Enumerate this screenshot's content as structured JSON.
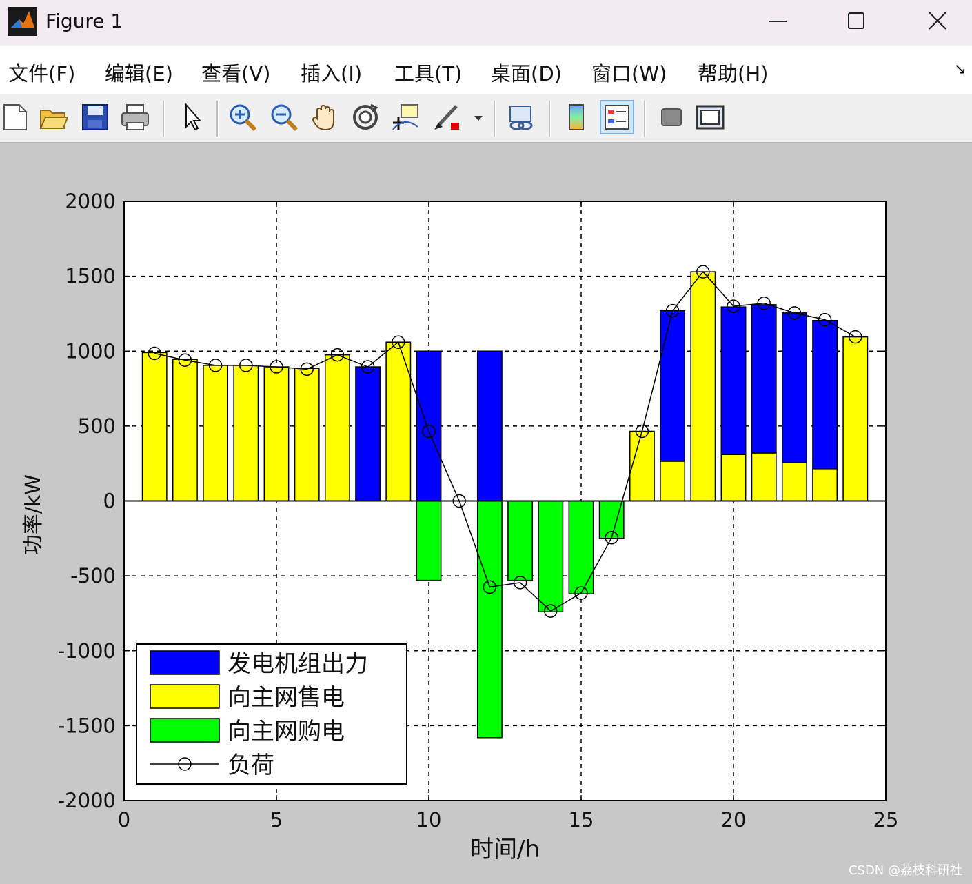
{
  "window": {
    "title": "Figure 1"
  },
  "menu": [
    {
      "label": "文件(F)"
    },
    {
      "label": "编辑(E)"
    },
    {
      "label": "查看(V)"
    },
    {
      "label": "插入(I)"
    },
    {
      "label": "工具(T)"
    },
    {
      "label": "桌面(D)"
    },
    {
      "label": "窗口(W)"
    },
    {
      "label": "帮助(H)"
    }
  ],
  "toolbar_icons": [
    "new-file-icon",
    "open-folder-icon",
    "save-icon",
    "print-icon",
    "pointer-icon",
    "zoom-in-icon",
    "zoom-out-icon",
    "pan-hand-icon",
    "rotate-3d-icon",
    "data-cursor-icon",
    "brush-icon",
    "brush-dropdown-icon",
    "link-plot-icon",
    "colorbar-icon",
    "legend-icon",
    "hide-plot-tools-icon",
    "show-plot-tools-icon"
  ],
  "colors": {
    "generator": "#0000ff",
    "sell": "#ffff00",
    "buy": "#00ff00",
    "load": "#000000",
    "titlebar": "#f4eaf2",
    "figure_bg": "#c8c8c8"
  },
  "watermark": "CSDN @荔枝科研社",
  "chart_data": {
    "type": "bar",
    "xlabel": "时间/h",
    "ylabel": "功率/kW",
    "xlim": [
      0,
      25
    ],
    "ylim": [
      -2000,
      2000
    ],
    "xticks": [
      0,
      5,
      10,
      15,
      20,
      25
    ],
    "yticks": [
      -2000,
      -1500,
      -1000,
      -500,
      0,
      500,
      1000,
      1500,
      2000
    ],
    "grid": true,
    "legend_position": "bottom-left",
    "x": [
      1,
      2,
      3,
      4,
      5,
      6,
      7,
      8,
      9,
      10,
      11,
      12,
      13,
      14,
      15,
      16,
      17,
      18,
      19,
      20,
      21,
      22,
      23,
      24
    ],
    "series": [
      {
        "name": "发电机组出力",
        "color": "#0000ff",
        "values": [
          0,
          0,
          0,
          0,
          0,
          0,
          0,
          895,
          0,
          1000,
          0,
          1000,
          0,
          0,
          0,
          0,
          0,
          1005,
          0,
          985,
          990,
          1000,
          990,
          0
        ]
      },
      {
        "name": "向主网售电",
        "color": "#ffff00",
        "values": [
          990,
          945,
          905,
          905,
          895,
          885,
          975,
          0,
          1060,
          0,
          0,
          0,
          0,
          0,
          0,
          0,
          465,
          265,
          1530,
          310,
          320,
          255,
          215,
          1095
        ]
      },
      {
        "name": "向主网购电",
        "color": "#00ff00",
        "values": [
          0,
          0,
          0,
          0,
          0,
          0,
          0,
          0,
          0,
          -530,
          0,
          -1580,
          -530,
          -740,
          -620,
          -250,
          0,
          0,
          0,
          0,
          0,
          0,
          0,
          0
        ]
      },
      {
        "name": "负荷",
        "color": "#000000",
        "type": "line",
        "marker": "circle",
        "values": [
          985,
          940,
          905,
          905,
          895,
          880,
          975,
          895,
          1060,
          465,
          0,
          -575,
          -545,
          -735,
          -615,
          -245,
          465,
          1270,
          1530,
          1300,
          1320,
          1255,
          1210,
          1095
        ]
      }
    ]
  }
}
